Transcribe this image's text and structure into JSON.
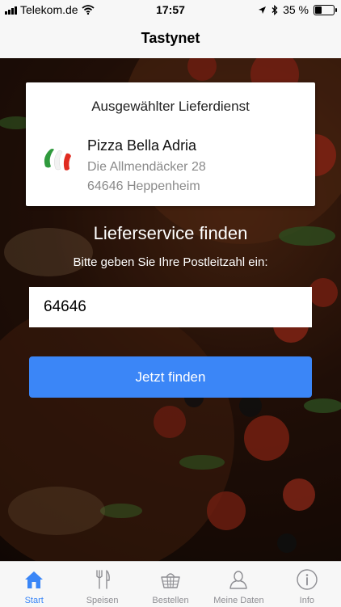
{
  "status": {
    "carrier": "Telekom.de",
    "time": "17:57",
    "battery": "35 %"
  },
  "nav": {
    "title": "Tastynet"
  },
  "card": {
    "heading": "Ausgewählter Lieferdienst",
    "name": "Pizza Bella Adria",
    "street": "Die Allmendäcker 28",
    "city": "64646 Heppenheim"
  },
  "finder": {
    "title": "Lieferservice finden",
    "prompt": "Bitte geben Sie Ihre Postleitzahl ein:",
    "zip": "64646",
    "button": "Jetzt finden"
  },
  "tabs": [
    {
      "label": "Start",
      "icon": "home-icon",
      "active": true
    },
    {
      "label": "Speisen",
      "icon": "cutlery-icon",
      "active": false
    },
    {
      "label": "Bestellen",
      "icon": "basket-icon",
      "active": false
    },
    {
      "label": "Meine Daten",
      "icon": "user-icon",
      "active": false
    },
    {
      "label": "Info",
      "icon": "info-icon",
      "active": false
    }
  ],
  "colors": {
    "accent": "#3b86f7",
    "tab_active": "#3a86f7",
    "tab_inactive": "#8e8e93"
  }
}
